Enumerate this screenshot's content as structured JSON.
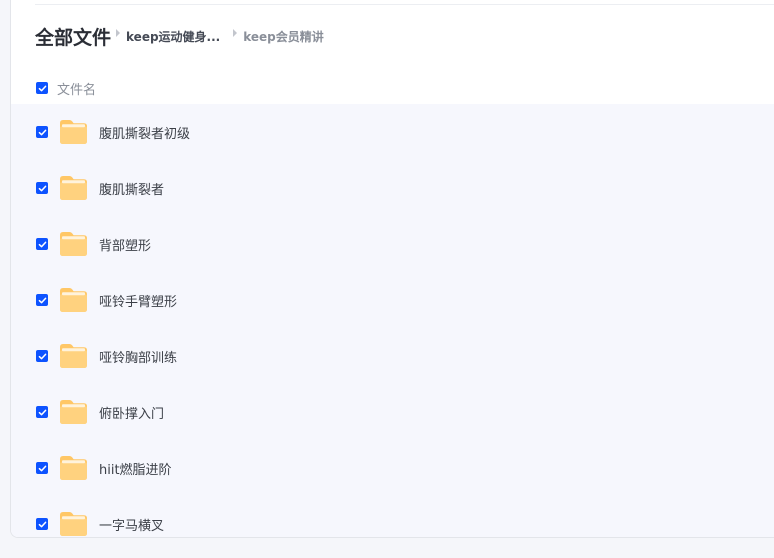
{
  "breadcrumb": {
    "root": "全部文件",
    "items": [
      "keep运动健身...",
      "keep会员精讲"
    ]
  },
  "list_header": {
    "name_column": "文件名",
    "select_all_checked": true
  },
  "files": [
    {
      "name": "腹肌撕裂者初级",
      "type": "folder",
      "checked": true
    },
    {
      "name": "腹肌撕裂者",
      "type": "folder",
      "checked": true
    },
    {
      "name": "背部塑形",
      "type": "folder",
      "checked": true
    },
    {
      "name": "哑铃手臂塑形",
      "type": "folder",
      "checked": true
    },
    {
      "name": "哑铃胸部训练",
      "type": "folder",
      "checked": true
    },
    {
      "name": "俯卧撑入门",
      "type": "folder",
      "checked": true
    },
    {
      "name": "hiit燃脂进阶",
      "type": "folder",
      "checked": true
    },
    {
      "name": "一字马横叉",
      "type": "folder",
      "checked": true
    }
  ],
  "icons": {
    "checkbox": "checkbox-checked-icon",
    "folder": "folder-icon",
    "separator": "caret-right-icon"
  },
  "colors": {
    "accent": "#0d53ff",
    "folder": "#ffc766",
    "folder_light": "#ffe1a6",
    "selected_bg": "#f6f7fd"
  }
}
